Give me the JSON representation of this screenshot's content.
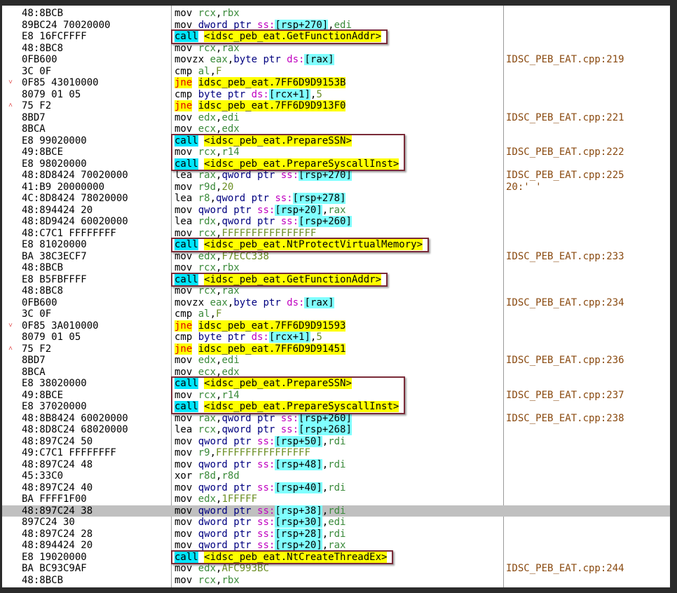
{
  "window": {
    "title": "x64dbg disassembly"
  },
  "rows": [
    {
      "bytes": "48:8BCB",
      "asm": [
        [
          "mn",
          "mov "
        ],
        [
          "reg",
          "rcx"
        ],
        [
          "pun",
          ","
        ],
        [
          "reg",
          "rbx"
        ]
      ],
      "comment": ""
    },
    {
      "bytes": "89BC24 70020000",
      "asm": [
        [
          "mn",
          "mov "
        ],
        [
          "sz",
          "dword ptr "
        ],
        [
          "seg",
          "ss:"
        ],
        [
          "brk",
          "[rsp+270]"
        ],
        [
          "pun",
          ","
        ],
        [
          "reg",
          "edi"
        ]
      ],
      "comment": ""
    },
    {
      "bytes": "E8 16FCFFFF",
      "asm": [
        [
          "call",
          "call"
        ],
        [
          "pun",
          " "
        ],
        [
          "tgt",
          "<idsc_peb_eat.GetFunctionAddr>"
        ]
      ],
      "comment": ""
    },
    {
      "bytes": "48:8BC8",
      "asm": [
        [
          "mn",
          "mov "
        ],
        [
          "reg",
          "rcx"
        ],
        [
          "pun",
          ","
        ],
        [
          "reg",
          "rax"
        ]
      ],
      "comment": ""
    },
    {
      "bytes": "0FB600",
      "asm": [
        [
          "mn",
          "movzx "
        ],
        [
          "reg",
          "eax"
        ],
        [
          "pun",
          ","
        ],
        [
          "sz",
          "byte ptr "
        ],
        [
          "seg",
          "ds:"
        ],
        [
          "brk",
          "[rax]"
        ]
      ],
      "comment": "IDSC_PEB_EAT.cpp:219"
    },
    {
      "bytes": "3C 0F",
      "asm": [
        [
          "mn",
          "cmp "
        ],
        [
          "reg",
          "al"
        ],
        [
          "pun",
          ","
        ],
        [
          "num",
          "F"
        ]
      ],
      "comment": ""
    },
    {
      "bytes": "0F85 43010000",
      "arrow": "˅",
      "asm": [
        [
          "jmp",
          "jne"
        ],
        [
          "pun",
          " "
        ],
        [
          "tgt",
          "idsc_peb_eat.7FF6D9D9153B"
        ]
      ],
      "comment": ""
    },
    {
      "bytes": "8079 01 05",
      "asm": [
        [
          "mn",
          "cmp "
        ],
        [
          "sz",
          "byte ptr "
        ],
        [
          "seg",
          "ds:"
        ],
        [
          "brk",
          "[rcx+1]"
        ],
        [
          "pun",
          ","
        ],
        [
          "num",
          "5"
        ]
      ],
      "comment": ""
    },
    {
      "bytes": "75 F2",
      "arrow": "˄",
      "asm": [
        [
          "jmp",
          "jne"
        ],
        [
          "pun",
          " "
        ],
        [
          "tgt",
          "idsc_peb_eat.7FF6D9D913F0"
        ]
      ],
      "comment": ""
    },
    {
      "bytes": "8BD7",
      "asm": [
        [
          "mn",
          "mov "
        ],
        [
          "reg",
          "edx"
        ],
        [
          "pun",
          ","
        ],
        [
          "reg",
          "edi"
        ]
      ],
      "comment": "IDSC_PEB_EAT.cpp:221"
    },
    {
      "bytes": "8BCA",
      "asm": [
        [
          "mn",
          "mov "
        ],
        [
          "reg",
          "ecx"
        ],
        [
          "pun",
          ","
        ],
        [
          "reg",
          "edx"
        ]
      ],
      "comment": ""
    },
    {
      "bytes": "E8 99020000",
      "asm": [
        [
          "call",
          "call"
        ],
        [
          "pun",
          " "
        ],
        [
          "tgt",
          "<idsc_peb_eat.PrepareSSN>"
        ]
      ],
      "comment": ""
    },
    {
      "bytes": "49:8BCE",
      "asm": [
        [
          "mn",
          "mov "
        ],
        [
          "reg",
          "rcx"
        ],
        [
          "pun",
          ","
        ],
        [
          "reg",
          "r14"
        ]
      ],
      "comment": "IDSC_PEB_EAT.cpp:222"
    },
    {
      "bytes": "E8 98020000",
      "asm": [
        [
          "call",
          "call"
        ],
        [
          "pun",
          " "
        ],
        [
          "tgt",
          "<idsc_peb_eat.PrepareSyscallInst>"
        ]
      ],
      "comment": ""
    },
    {
      "bytes": "48:8D8424 70020000",
      "asm": [
        [
          "mn",
          "lea "
        ],
        [
          "reg",
          "rax"
        ],
        [
          "pun",
          ","
        ],
        [
          "sz",
          "qword ptr "
        ],
        [
          "seg",
          "ss:"
        ],
        [
          "brk",
          "[rsp+270]"
        ]
      ],
      "comment": "IDSC_PEB_EAT.cpp:225"
    },
    {
      "bytes": "41:B9 20000000",
      "asm": [
        [
          "mn",
          "mov "
        ],
        [
          "reg",
          "r9d"
        ],
        [
          "pun",
          ","
        ],
        [
          "num",
          "20"
        ]
      ],
      "comment": "20:' '"
    },
    {
      "bytes": "4C:8D8424 78020000",
      "asm": [
        [
          "mn",
          "lea "
        ],
        [
          "reg",
          "r8"
        ],
        [
          "pun",
          ","
        ],
        [
          "sz",
          "qword ptr "
        ],
        [
          "seg",
          "ss:"
        ],
        [
          "brk",
          "[rsp+278]"
        ]
      ],
      "comment": ""
    },
    {
      "bytes": "48:894424 20",
      "asm": [
        [
          "mn",
          "mov "
        ],
        [
          "sz",
          "qword ptr "
        ],
        [
          "seg",
          "ss:"
        ],
        [
          "brk",
          "[rsp+20]"
        ],
        [
          "pun",
          ","
        ],
        [
          "reg",
          "rax"
        ]
      ],
      "comment": ""
    },
    {
      "bytes": "48:8D9424 60020000",
      "asm": [
        [
          "mn",
          "lea "
        ],
        [
          "reg",
          "rdx"
        ],
        [
          "pun",
          ","
        ],
        [
          "sz",
          "qword ptr "
        ],
        [
          "seg",
          "ss:"
        ],
        [
          "brk",
          "[rsp+260]"
        ]
      ],
      "comment": ""
    },
    {
      "bytes": "48:C7C1 FFFFFFFF",
      "asm": [
        [
          "mn",
          "mov "
        ],
        [
          "reg",
          "rcx"
        ],
        [
          "pun",
          ","
        ],
        [
          "num",
          "FFFFFFFFFFFFFFFF"
        ]
      ],
      "comment": ""
    },
    {
      "bytes": "E8 81020000",
      "asm": [
        [
          "call",
          "call"
        ],
        [
          "pun",
          " "
        ],
        [
          "tgt",
          "<idsc_peb_eat.NtProtectVirtualMemory>"
        ]
      ],
      "comment": ""
    },
    {
      "bytes": "BA 38C3ECF7",
      "asm": [
        [
          "mn",
          "mov "
        ],
        [
          "reg",
          "edx"
        ],
        [
          "pun",
          ","
        ],
        [
          "num",
          "F7ECC338"
        ]
      ],
      "comment": "IDSC_PEB_EAT.cpp:233"
    },
    {
      "bytes": "48:8BCB",
      "asm": [
        [
          "mn",
          "mov "
        ],
        [
          "reg",
          "rcx"
        ],
        [
          "pun",
          ","
        ],
        [
          "reg",
          "rbx"
        ]
      ],
      "comment": ""
    },
    {
      "bytes": "E8 B5FBFFFF",
      "asm": [
        [
          "call",
          "call"
        ],
        [
          "pun",
          " "
        ],
        [
          "tgt",
          "<idsc_peb_eat.GetFunctionAddr>"
        ]
      ],
      "comment": ""
    },
    {
      "bytes": "48:8BC8",
      "asm": [
        [
          "mn",
          "mov "
        ],
        [
          "reg",
          "rcx"
        ],
        [
          "pun",
          ","
        ],
        [
          "reg",
          "rax"
        ]
      ],
      "comment": ""
    },
    {
      "bytes": "0FB600",
      "asm": [
        [
          "mn",
          "movzx "
        ],
        [
          "reg",
          "eax"
        ],
        [
          "pun",
          ","
        ],
        [
          "sz",
          "byte ptr "
        ],
        [
          "seg",
          "ds:"
        ],
        [
          "brk",
          "[rax]"
        ]
      ],
      "comment": "IDSC_PEB_EAT.cpp:234"
    },
    {
      "bytes": "3C 0F",
      "asm": [
        [
          "mn",
          "cmp "
        ],
        [
          "reg",
          "al"
        ],
        [
          "pun",
          ","
        ],
        [
          "num",
          "F"
        ]
      ],
      "comment": ""
    },
    {
      "bytes": "0F85 3A010000",
      "arrow": "˅",
      "asm": [
        [
          "jmp",
          "jne"
        ],
        [
          "pun",
          " "
        ],
        [
          "tgt",
          "idsc_peb_eat.7FF6D9D91593"
        ]
      ],
      "comment": ""
    },
    {
      "bytes": "8079 01 05",
      "asm": [
        [
          "mn",
          "cmp "
        ],
        [
          "sz",
          "byte ptr "
        ],
        [
          "seg",
          "ds:"
        ],
        [
          "brk",
          "[rcx+1]"
        ],
        [
          "pun",
          ","
        ],
        [
          "num",
          "5"
        ]
      ],
      "comment": ""
    },
    {
      "bytes": "75 F2",
      "arrow": "˄",
      "asm": [
        [
          "jmp",
          "jne"
        ],
        [
          "pun",
          " "
        ],
        [
          "tgt",
          "idsc_peb_eat.7FF6D9D91451"
        ]
      ],
      "comment": ""
    },
    {
      "bytes": "8BD7",
      "asm": [
        [
          "mn",
          "mov "
        ],
        [
          "reg",
          "edx"
        ],
        [
          "pun",
          ","
        ],
        [
          "reg",
          "edi"
        ]
      ],
      "comment": "IDSC_PEB_EAT.cpp:236"
    },
    {
      "bytes": "8BCA",
      "asm": [
        [
          "mn",
          "mov "
        ],
        [
          "reg",
          "ecx"
        ],
        [
          "pun",
          ","
        ],
        [
          "reg",
          "edx"
        ]
      ],
      "comment": ""
    },
    {
      "bytes": "E8 38020000",
      "asm": [
        [
          "call",
          "call"
        ],
        [
          "pun",
          " "
        ],
        [
          "tgt",
          "<idsc_peb_eat.PrepareSSN>"
        ]
      ],
      "comment": ""
    },
    {
      "bytes": "49:8BCE",
      "asm": [
        [
          "mn",
          "mov "
        ],
        [
          "reg",
          "rcx"
        ],
        [
          "pun",
          ","
        ],
        [
          "reg",
          "r14"
        ]
      ],
      "comment": "IDSC_PEB_EAT.cpp:237"
    },
    {
      "bytes": "E8 37020000",
      "asm": [
        [
          "call",
          "call"
        ],
        [
          "pun",
          " "
        ],
        [
          "tgt",
          "<idsc_peb_eat.PrepareSyscallInst>"
        ]
      ],
      "comment": ""
    },
    {
      "bytes": "48:8B8424 60020000",
      "asm": [
        [
          "mn",
          "mov "
        ],
        [
          "reg",
          "rax"
        ],
        [
          "pun",
          ","
        ],
        [
          "sz",
          "qword ptr "
        ],
        [
          "seg",
          "ss:"
        ],
        [
          "brk",
          "[rsp+260]"
        ]
      ],
      "comment": "IDSC_PEB_EAT.cpp:238"
    },
    {
      "bytes": "48:8D8C24 68020000",
      "asm": [
        [
          "mn",
          "lea "
        ],
        [
          "reg",
          "rcx"
        ],
        [
          "pun",
          ","
        ],
        [
          "sz",
          "qword ptr "
        ],
        [
          "seg",
          "ss:"
        ],
        [
          "brk",
          "[rsp+268]"
        ]
      ],
      "comment": ""
    },
    {
      "bytes": "48:897C24 50",
      "asm": [
        [
          "mn",
          "mov "
        ],
        [
          "sz",
          "qword ptr "
        ],
        [
          "seg",
          "ss:"
        ],
        [
          "brk",
          "[rsp+50]"
        ],
        [
          "pun",
          ","
        ],
        [
          "reg",
          "rdi"
        ]
      ],
      "comment": ""
    },
    {
      "bytes": "49:C7C1 FFFFFFFF",
      "asm": [
        [
          "mn",
          "mov "
        ],
        [
          "reg",
          "r9"
        ],
        [
          "pun",
          ","
        ],
        [
          "num",
          "FFFFFFFFFFFFFFFF"
        ]
      ],
      "comment": ""
    },
    {
      "bytes": "48:897C24 48",
      "asm": [
        [
          "mn",
          "mov "
        ],
        [
          "sz",
          "qword ptr "
        ],
        [
          "seg",
          "ss:"
        ],
        [
          "brk",
          "[rsp+48]"
        ],
        [
          "pun",
          ","
        ],
        [
          "reg",
          "rdi"
        ]
      ],
      "comment": ""
    },
    {
      "bytes": "45:33C0",
      "asm": [
        [
          "mn",
          "xor "
        ],
        [
          "reg",
          "r8d"
        ],
        [
          "pun",
          ","
        ],
        [
          "reg",
          "r8d"
        ]
      ],
      "comment": ""
    },
    {
      "bytes": "48:897C24 40",
      "asm": [
        [
          "mn",
          "mov "
        ],
        [
          "sz",
          "qword ptr "
        ],
        [
          "seg",
          "ss:"
        ],
        [
          "brk",
          "[rsp+40]"
        ],
        [
          "pun",
          ","
        ],
        [
          "reg",
          "rdi"
        ]
      ],
      "comment": ""
    },
    {
      "bytes": "BA FFFF1F00",
      "asm": [
        [
          "mn",
          "mov "
        ],
        [
          "reg",
          "edx"
        ],
        [
          "pun",
          ","
        ],
        [
          "num",
          "1FFFFF"
        ]
      ],
      "comment": ""
    },
    {
      "bytes": "48:897C24 38",
      "selected": true,
      "asm": [
        [
          "mn",
          "mov "
        ],
        [
          "sz",
          "qword ptr "
        ],
        [
          "seg",
          "ss:"
        ],
        [
          "brk",
          "[rsp+38]"
        ],
        [
          "pun",
          ","
        ],
        [
          "reg",
          "rdi"
        ]
      ],
      "comment": ""
    },
    {
      "bytes": "897C24 30",
      "asm": [
        [
          "mn",
          "mov "
        ],
        [
          "sz",
          "dword ptr "
        ],
        [
          "seg",
          "ss:"
        ],
        [
          "brk",
          "[rsp+30]"
        ],
        [
          "pun",
          ","
        ],
        [
          "reg",
          "edi"
        ]
      ],
      "comment": ""
    },
    {
      "bytes": "48:897C24 28",
      "asm": [
        [
          "mn",
          "mov "
        ],
        [
          "sz",
          "qword ptr "
        ],
        [
          "seg",
          "ss:"
        ],
        [
          "brk",
          "[rsp+28]"
        ],
        [
          "pun",
          ","
        ],
        [
          "reg",
          "rdi"
        ]
      ],
      "comment": ""
    },
    {
      "bytes": "48:894424 20",
      "asm": [
        [
          "mn",
          "mov "
        ],
        [
          "sz",
          "qword ptr "
        ],
        [
          "seg",
          "ss:"
        ],
        [
          "brk",
          "[rsp+20]"
        ],
        [
          "pun",
          ","
        ],
        [
          "reg",
          "rax"
        ]
      ],
      "comment": ""
    },
    {
      "bytes": "E8 19020000",
      "asm": [
        [
          "call",
          "call"
        ],
        [
          "pun",
          " "
        ],
        [
          "tgt",
          "<idsc_peb_eat.NtCreateThreadEx>"
        ]
      ],
      "comment": ""
    },
    {
      "bytes": "BA BC93C9AF",
      "asm": [
        [
          "mn",
          "mov "
        ],
        [
          "reg",
          "edx"
        ],
        [
          "pun",
          ","
        ],
        [
          "num",
          "AFC993BC"
        ]
      ],
      "comment": "IDSC_PEB_EAT.cpp:244"
    },
    {
      "bytes": "48:8BCB",
      "asm": [
        [
          "mn",
          "mov "
        ],
        [
          "reg",
          "rcx"
        ],
        [
          "pun",
          ","
        ],
        [
          "reg",
          "rbx"
        ]
      ],
      "comment": ""
    }
  ],
  "highlight_boxes": [
    {
      "name": "highlight-getfunctionaddr-1",
      "rows": [
        2,
        2
      ]
    },
    {
      "name": "highlight-preparessn-group-1",
      "rows": [
        11,
        13
      ]
    },
    {
      "name": "highlight-ntprotectvirtualmemory",
      "rows": [
        20,
        20
      ]
    },
    {
      "name": "highlight-getfunctionaddr-2",
      "rows": [
        23,
        23
      ]
    },
    {
      "name": "highlight-preparessn-group-2",
      "rows": [
        32,
        34
      ]
    },
    {
      "name": "highlight-ntcreatethreadex",
      "rows": [
        47,
        47
      ]
    }
  ]
}
